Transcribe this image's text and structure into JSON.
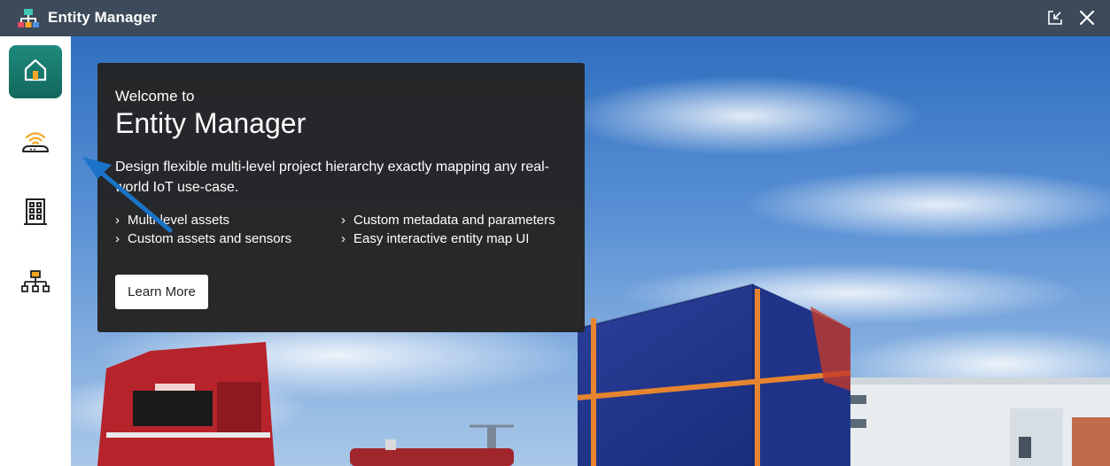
{
  "titlebar": {
    "title": "Entity Manager",
    "app_icon": "hierarchy-icon",
    "restore_icon": "restore-window-icon",
    "close_icon": "close-icon"
  },
  "sidebar": {
    "items": [
      {
        "name": "home",
        "icon": "home-icon",
        "active": true
      },
      {
        "name": "sensors",
        "icon": "wireless-gateway-icon",
        "active": false
      },
      {
        "name": "assets",
        "icon": "building-icon",
        "active": false
      },
      {
        "name": "hierarchy",
        "icon": "hierarchy-icon",
        "active": false
      }
    ]
  },
  "welcome": {
    "pre_title": "Welcome to",
    "title": "Entity Manager",
    "description": "Design flexible multi-level project hierarchy exactly mapping any real-world IoT use-case.",
    "features": [
      "Multi-level assets",
      "Custom assets and sensors",
      "Custom metadata and parameters",
      "Easy interactive entity map UI"
    ],
    "learn_more_label": "Learn More"
  },
  "colors": {
    "titlebar_bg": "#3c4a5a",
    "active_nav": "#1a7d70",
    "card_bg": "#242424",
    "accent_orange": "#f5a623"
  }
}
